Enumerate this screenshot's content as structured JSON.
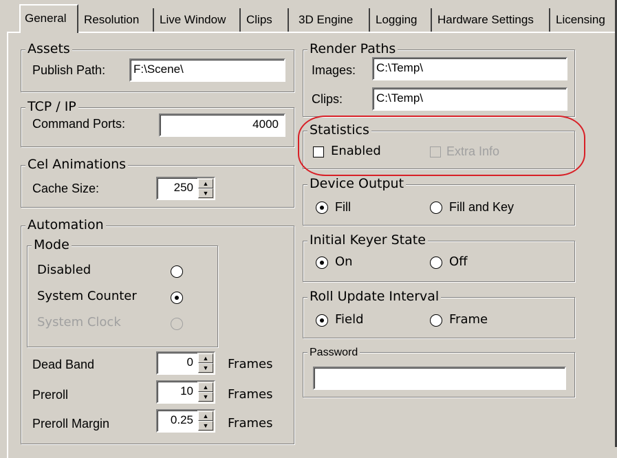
{
  "tabs": [
    "General",
    "Resolution",
    "Live Window",
    "Clips",
    "3D Engine",
    "Logging",
    "Hardware Settings",
    "Licensing"
  ],
  "assets": {
    "title": "Assets",
    "publish_label": "Publish Path:",
    "publish_value": "F:\\Scene\\"
  },
  "tcp": {
    "title": "TCP / IP",
    "ports_label": "Command Ports:",
    "ports_value": "4000"
  },
  "cel": {
    "title": "Cel Animations",
    "cache_label": "Cache Size:",
    "cache_value": "250"
  },
  "automation": {
    "title": "Automation",
    "mode_title": "Mode",
    "modes": [
      {
        "label": "Disabled",
        "selected": false,
        "enabled": true
      },
      {
        "label": "System Counter",
        "selected": true,
        "enabled": true
      },
      {
        "label": "System Clock",
        "selected": false,
        "enabled": false
      }
    ],
    "dead_band_label": "Dead Band",
    "dead_band_value": "0",
    "preroll_label": "Preroll",
    "preroll_value": "10",
    "preroll_margin_label": "Preroll Margin",
    "preroll_margin_value": "0.25",
    "frames_label": "Frames"
  },
  "render_paths": {
    "title": "Render Paths",
    "images_label": "Images:",
    "images_value": "C:\\Temp\\",
    "clips_label": "Clips:",
    "clips_value": "C:\\Temp\\"
  },
  "statistics": {
    "title": "Statistics",
    "enabled_label": "Enabled",
    "extra_label": "Extra Info"
  },
  "device_output": {
    "title": "Device Output",
    "fill_label": "Fill",
    "fill_key_label": "Fill and Key"
  },
  "keyer": {
    "title": "Initial Keyer State",
    "on_label": "On",
    "off_label": "Off"
  },
  "roll": {
    "title": "Roll Update Interval",
    "field_label": "Field",
    "frame_label": "Frame"
  },
  "password": {
    "title": "Password",
    "value": ""
  },
  "colors": {
    "background": "#d4d0c8",
    "highlight": "#d81f26",
    "disabled_text": "#a0a0a0"
  }
}
